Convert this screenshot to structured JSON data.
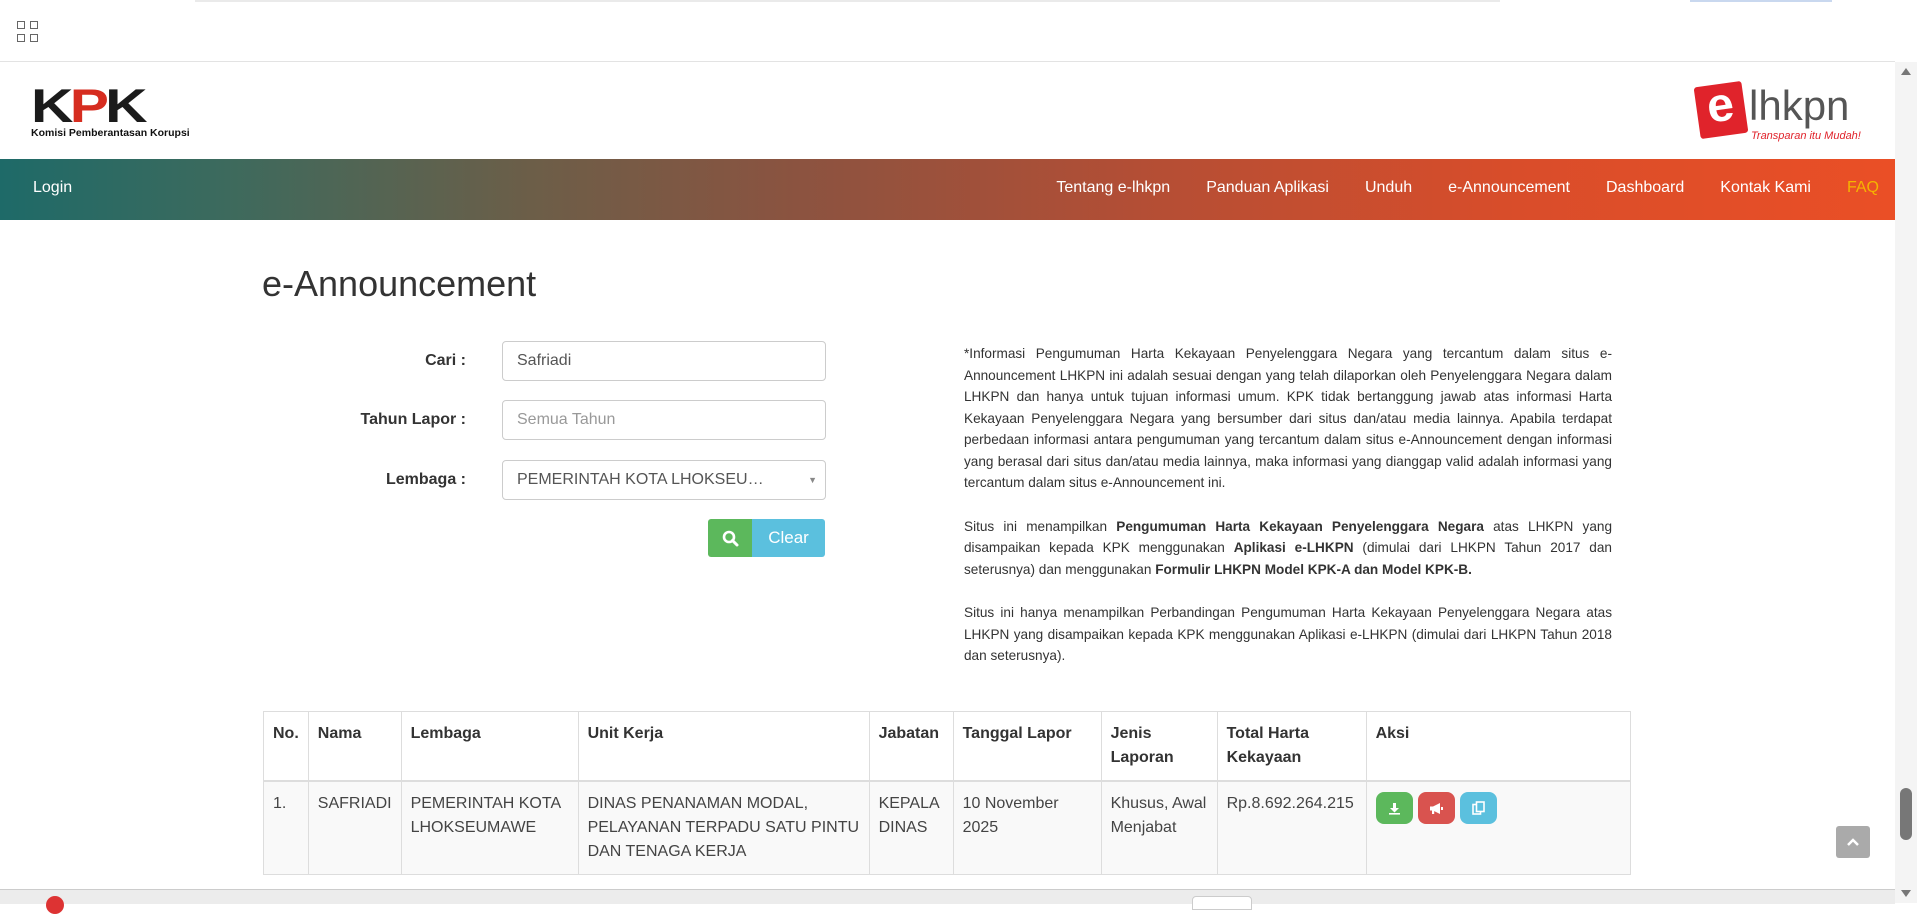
{
  "navbar": {
    "login": "Login",
    "menu": [
      "Tentang e-lhkpn",
      "Panduan Aplikasi",
      "Unduh",
      "e-Announcement",
      "Dashboard",
      "Kontak Kami",
      "FAQ"
    ]
  },
  "header": {
    "kpk_logo_text": "KPK",
    "kpk_logo_sub": "Komisi Pemberantasan Korupsi",
    "elhkpn_e": "e",
    "elhkpn_text": "lhkpn",
    "elhkpn_tagline": "Transparan itu Mudah!"
  },
  "page": {
    "title": "e-Announcement"
  },
  "form": {
    "cari_label": "Cari :",
    "cari_value": "Safriadi",
    "tahun_label": "Tahun Lapor :",
    "tahun_placeholder": "Semua Tahun",
    "lembaga_label": "Lembaga :",
    "lembaga_value": "PEMERINTAH KOTA LHOKSEU…",
    "clear_label": "Clear"
  },
  "info": {
    "p1": "*Informasi Pengumuman Harta Kekayaan Penyelenggara Negara yang tercantum dalam situs e-Announcement LHKPN ini adalah sesuai dengan yang telah dilaporkan oleh Penyelenggara Negara dalam LHKPN dan hanya untuk tujuan informasi umum. KPK tidak bertanggung jawab atas informasi Harta Kekayaan Penyelenggara Negara yang bersumber dari situs dan/atau media lainnya. Apabila terdapat perbedaan informasi antara pengumuman yang tercantum dalam situs e-Announcement dengan informasi yang berasal dari situs dan/atau media lainnya, maka informasi yang dianggap valid adalah informasi yang tercantum dalam situs e-Announcement ini.",
    "p2_a": "Situs ini menampilkan ",
    "p2_b": "Pengumuman Harta Kekayaan Penyelenggara Negara",
    "p2_c": " atas LHKPN yang disampaikan kepada KPK menggunakan ",
    "p2_d": "Aplikasi e-LHKPN",
    "p2_e": " (dimulai dari LHKPN Tahun 2017 dan seterusnya) dan menggunakan ",
    "p2_f": "Formulir LHKPN Model KPK-A dan Model KPK-B.",
    "p3": "Situs ini hanya menampilkan Perbandingan Pengumuman Harta Kekayaan Penyelenggara Negara atas LHKPN yang disampaikan kepada KPK menggunakan Aplikasi e-LHKPN (dimulai dari LHKPN Tahun 2018 dan seterusnya)."
  },
  "table": {
    "headers": [
      "No.",
      "Nama",
      "Lembaga",
      "Unit Kerja",
      "Jabatan",
      "Tanggal Lapor",
      "Jenis Laporan",
      "Total Harta Kekayaan",
      "Aksi"
    ],
    "rows": [
      {
        "no": "1.",
        "nama": "SAFRIADI",
        "lembaga": "PEMERINTAH KOTA LHOKSEUMAWE",
        "unit_kerja": "DINAS PENANAMAN MODAL, PELAYANAN TERPADU SATU PINTU DAN TENAGA KERJA",
        "jabatan": "KEPALA DINAS",
        "tanggal": "10 November 2025",
        "jenis": "Khusus, Awal Menjabat",
        "total": "Rp.8.692.264.215"
      }
    ]
  },
  "icons": {
    "apps": "grid-icon",
    "search": "search-icon",
    "download": "download-icon",
    "announce": "megaphone-icon",
    "compare": "copy-icon",
    "scroll_top": "chevron-up-icon"
  },
  "colors": {
    "green": "#5cb85c",
    "red": "#d9534f",
    "cyan": "#5bc0de",
    "faq": "#f5b400"
  }
}
